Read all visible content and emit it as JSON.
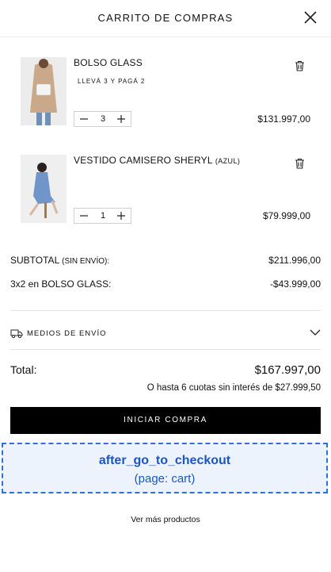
{
  "header": {
    "title": "CARRITO DE COMPRAS"
  },
  "items": [
    {
      "name": "BOLSO GLASS",
      "variant": "",
      "promo": "LLEVÁ 3 Y PAGÁ 2",
      "quantity": "3",
      "price": "$131.997,00"
    },
    {
      "name": "VESTIDO CAMISERO SHERYL",
      "variant": "(AZUL)",
      "promo": "",
      "quantity": "1",
      "price": "$79.999,00"
    }
  ],
  "summary": {
    "subtotal_label": "SUBTOTAL",
    "subtotal_note": "(SIN ENVÍO):",
    "subtotal_value": "$211.996,00",
    "discount_label": "3x2 en BOLSO GLASS:",
    "discount_value": "-$43.999,00"
  },
  "shipping": {
    "label": "MEDIOS DE ENVÍO"
  },
  "total": {
    "label": "Total:",
    "value": "$167.997,00",
    "installments": "O hasta 6 cuotas sin interés de $27.999,50"
  },
  "cta": {
    "label": "INICIAR COMPRA"
  },
  "overlay": {
    "title": "after_go_to_checkout",
    "subtitle": "(page: cart)"
  },
  "footer": {
    "more_label": "Ver más productos"
  },
  "colors": {
    "accent": "#000000",
    "overlay_blue": "#1a56c8",
    "overlay_border": "#2f6fe0"
  },
  "icons": [
    "close-icon",
    "trash-icon",
    "minus-icon",
    "plus-icon",
    "truck-icon",
    "chevron-down-icon"
  ]
}
